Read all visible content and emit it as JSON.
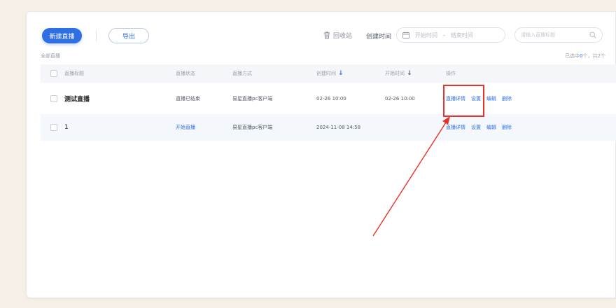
{
  "toolbar": {
    "create_label": "新建直播",
    "export_label": "导出",
    "recycle_label": "回收站",
    "time_label": "创建时间",
    "date_start_placeholder": "开始时间",
    "date_separator": "-",
    "date_end_placeholder": "结束时间",
    "search_placeholder": "请输入直播标题"
  },
  "list": {
    "all_label": "全部直播",
    "selection_prefix": "已选中",
    "selected_count": "0",
    "selection_suffix": "个，共2个"
  },
  "table": {
    "headers": {
      "title": "直播标题",
      "status": "直播状态",
      "method": "直播方式",
      "created": "创建时间",
      "start": "开始时间",
      "ops": "操作"
    },
    "rows": [
      {
        "title": "测试直播",
        "status": "直播已结束",
        "method": "易星直播pc客户端",
        "created": "02-26 10:00",
        "start": "02-26 10:00",
        "ops": [
          "直播详情",
          "设置",
          "编辑",
          "删除"
        ]
      },
      {
        "title": "1",
        "status": "开始直播",
        "method": "易星直播pc客户端",
        "created": "2024-11-08 14:58",
        "start": "",
        "ops": [
          "直播详情",
          "设置",
          "编辑",
          "删除"
        ]
      }
    ]
  },
  "colors": {
    "accent": "#2f6fe4",
    "annotation": "#e8322c",
    "background": "#f5efe6"
  },
  "icons": {
    "recycle": "trash-icon",
    "date": "calendar-icon",
    "search": "search-icon",
    "sort": "arrow-down-icon"
  }
}
